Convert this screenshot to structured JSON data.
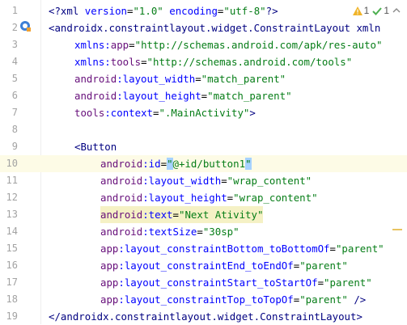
{
  "inspections": {
    "warnings": "1",
    "weak_warnings": "1"
  },
  "lines": [
    {
      "n": "1",
      "indent": 0,
      "parts": [
        {
          "t": "<?xml ",
          "c": "tag"
        },
        {
          "t": "version",
          "c": "attr"
        },
        {
          "t": "=",
          "c": "pl"
        },
        {
          "t": "\"1.0\"",
          "c": "val"
        },
        {
          "t": " ",
          "c": "pl"
        },
        {
          "t": "encoding",
          "c": "attr"
        },
        {
          "t": "=",
          "c": "pl"
        },
        {
          "t": "\"utf-8\"",
          "c": "val"
        },
        {
          "t": "?>",
          "c": "tag"
        }
      ]
    },
    {
      "n": "2",
      "indent": 0,
      "parts": [
        {
          "t": "<androidx.constraintlayout.widget.ConstraintLayout xmln",
          "c": "tag"
        }
      ]
    },
    {
      "n": "3",
      "indent": 1,
      "parts": [
        {
          "t": "xmlns:",
          "c": "attr"
        },
        {
          "t": "app",
          "c": "ns"
        },
        {
          "t": "=",
          "c": "pl"
        },
        {
          "t": "\"http://schemas.android.com/apk/res-auto\"",
          "c": "val"
        }
      ]
    },
    {
      "n": "4",
      "indent": 1,
      "parts": [
        {
          "t": "xmlns:",
          "c": "attr"
        },
        {
          "t": "tools",
          "c": "ns"
        },
        {
          "t": "=",
          "c": "pl"
        },
        {
          "t": "\"http://schemas.android.com/tools\"",
          "c": "val"
        }
      ]
    },
    {
      "n": "5",
      "indent": 1,
      "parts": [
        {
          "t": "android",
          "c": "ns"
        },
        {
          "t": ":layout_width",
          "c": "attr"
        },
        {
          "t": "=",
          "c": "pl"
        },
        {
          "t": "\"match_parent\"",
          "c": "val"
        }
      ]
    },
    {
      "n": "6",
      "indent": 1,
      "parts": [
        {
          "t": "android",
          "c": "ns"
        },
        {
          "t": ":layout_height",
          "c": "attr"
        },
        {
          "t": "=",
          "c": "pl"
        },
        {
          "t": "\"match_parent\"",
          "c": "val"
        }
      ]
    },
    {
      "n": "7",
      "indent": 1,
      "parts": [
        {
          "t": "tools",
          "c": "ns"
        },
        {
          "t": ":context",
          "c": "attr"
        },
        {
          "t": "=",
          "c": "pl"
        },
        {
          "t": "\".MainActivity\"",
          "c": "val"
        },
        {
          "t": ">",
          "c": "tag"
        }
      ]
    },
    {
      "n": "8",
      "indent": 0,
      "parts": []
    },
    {
      "n": "9",
      "indent": 1,
      "parts": [
        {
          "t": "<Button",
          "c": "tag"
        }
      ]
    },
    {
      "n": "10",
      "indent": 2,
      "current": true,
      "parts": [
        {
          "t": "android",
          "c": "ns"
        },
        {
          "t": ":id",
          "c": "attr"
        },
        {
          "t": "=",
          "c": "pl"
        },
        {
          "t": "\"",
          "c": "val",
          "caret": true
        },
        {
          "t": "@+id/button1",
          "c": "val"
        },
        {
          "t": "\"",
          "c": "val",
          "caret": true
        }
      ]
    },
    {
      "n": "11",
      "indent": 2,
      "parts": [
        {
          "t": "android",
          "c": "ns"
        },
        {
          "t": ":layout_width",
          "c": "attr"
        },
        {
          "t": "=",
          "c": "pl"
        },
        {
          "t": "\"wrap_content\"",
          "c": "val"
        }
      ]
    },
    {
      "n": "12",
      "indent": 2,
      "parts": [
        {
          "t": "android",
          "c": "ns"
        },
        {
          "t": ":layout_height",
          "c": "attr"
        },
        {
          "t": "=",
          "c": "pl"
        },
        {
          "t": "\"wrap_content\"",
          "c": "val"
        }
      ]
    },
    {
      "n": "13",
      "indent": 2,
      "hl": true,
      "parts": [
        {
          "t": "android",
          "c": "ns"
        },
        {
          "t": ":text",
          "c": "attr"
        },
        {
          "t": "=",
          "c": "pl"
        },
        {
          "t": "\"Next Ativity\"",
          "c": "val"
        }
      ]
    },
    {
      "n": "14",
      "indent": 2,
      "parts": [
        {
          "t": "android",
          "c": "ns"
        },
        {
          "t": ":textSize",
          "c": "attr"
        },
        {
          "t": "=",
          "c": "pl"
        },
        {
          "t": "\"30sp\"",
          "c": "val"
        }
      ]
    },
    {
      "n": "15",
      "indent": 2,
      "parts": [
        {
          "t": "app",
          "c": "ns"
        },
        {
          "t": ":layout_constraintBottom_toBottomOf",
          "c": "attr"
        },
        {
          "t": "=",
          "c": "pl"
        },
        {
          "t": "\"parent\"",
          "c": "val"
        }
      ]
    },
    {
      "n": "16",
      "indent": 2,
      "parts": [
        {
          "t": "app",
          "c": "ns"
        },
        {
          "t": ":layout_constraintEnd_toEndOf",
          "c": "attr"
        },
        {
          "t": "=",
          "c": "pl"
        },
        {
          "t": "\"parent\"",
          "c": "val"
        }
      ]
    },
    {
      "n": "17",
      "indent": 2,
      "parts": [
        {
          "t": "app",
          "c": "ns"
        },
        {
          "t": ":layout_constraintStart_toStartOf",
          "c": "attr"
        },
        {
          "t": "=",
          "c": "pl"
        },
        {
          "t": "\"parent\"",
          "c": "val"
        }
      ]
    },
    {
      "n": "18",
      "indent": 2,
      "parts": [
        {
          "t": "app",
          "c": "ns"
        },
        {
          "t": ":layout_constraintTop_toTopOf",
          "c": "attr"
        },
        {
          "t": "=",
          "c": "pl"
        },
        {
          "t": "\"parent\"",
          "c": "val"
        },
        {
          "t": " />",
          "c": "tag"
        }
      ]
    },
    {
      "n": "19",
      "indent": 0,
      "parts": [
        {
          "t": "</androidx.constraintlayout.widget.ConstraintLayout>",
          "c": "tag"
        }
      ]
    }
  ],
  "colors": {
    "tag": "#000080",
    "namespace": "#660e7a",
    "attribute": "#0000ff",
    "value": "#067d17"
  },
  "icons": {
    "gutter": "activity-layout-icon",
    "warning": "warning-triangle-icon",
    "check": "check-icon"
  }
}
